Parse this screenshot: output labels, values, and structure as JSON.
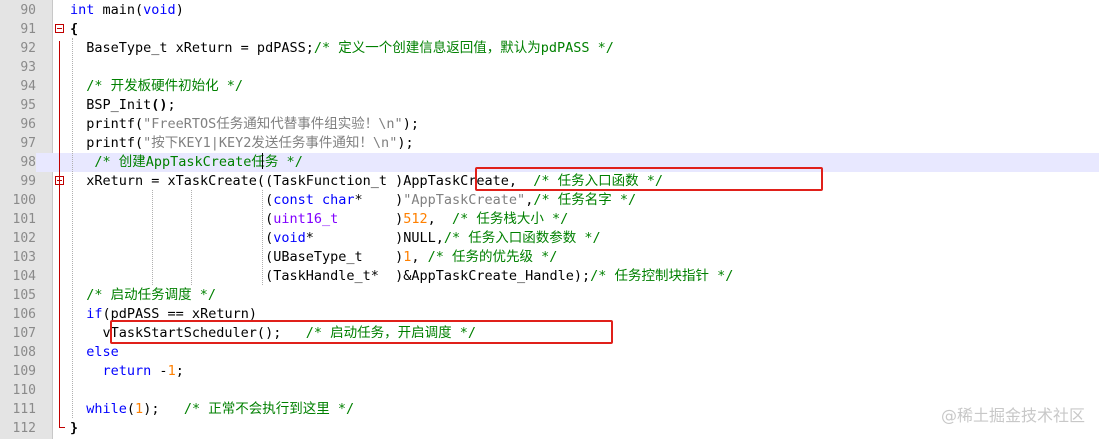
{
  "editor": {
    "lines": [
      {
        "num": "90",
        "tokens": [
          {
            "t": "int",
            "c": "kw"
          },
          {
            "t": " main("
          },
          {
            "t": "void",
            "c": "kw"
          },
          {
            "t": ")"
          }
        ]
      },
      {
        "num": "91",
        "tokens": [
          {
            "t": "{",
            "c": "bold"
          }
        ]
      },
      {
        "num": "92",
        "tokens": [
          {
            "t": "  BaseType_t xReturn = pdPASS;"
          },
          {
            "t": "/* 定义一个创建信息返回值，默认为pdPASS */",
            "c": "cm"
          }
        ]
      },
      {
        "num": "93",
        "tokens": []
      },
      {
        "num": "94",
        "tokens": [
          {
            "t": "  "
          },
          {
            "t": "/* 开发板硬件初始化 */",
            "c": "cm"
          }
        ]
      },
      {
        "num": "95",
        "tokens": [
          {
            "t": "  BSP_Init"
          },
          {
            "t": "()",
            "c": "bold"
          },
          {
            "t": ";"
          }
        ]
      },
      {
        "num": "96",
        "tokens": [
          {
            "t": "  printf("
          },
          {
            "t": "\"FreeRTOS任务通知代替事件组实验！\\n\"",
            "c": "str"
          },
          {
            "t": ");"
          }
        ]
      },
      {
        "num": "97",
        "tokens": [
          {
            "t": "  printf("
          },
          {
            "t": "\"按下KEY1|KEY2发送任务事件通知！\\n\"",
            "c": "str"
          },
          {
            "t": ");"
          }
        ]
      },
      {
        "num": "98",
        "tokens": [
          {
            "t": "   "
          },
          {
            "t": "/* 创建AppTaskCreate任务 */",
            "c": "cm"
          }
        ]
      },
      {
        "num": "99",
        "tokens": [
          {
            "t": "  xReturn = xTaskCreate((TaskFunction_t )AppTaskCreate,  "
          },
          {
            "t": "/* 任务入口函数 */",
            "c": "cm"
          }
        ]
      },
      {
        "num": "100",
        "tokens": [
          {
            "t": "                        ("
          },
          {
            "t": "const char",
            "c": "kw"
          },
          {
            "t": "*    )"
          },
          {
            "t": "\"AppTaskCreate\"",
            "c": "str"
          },
          {
            "t": ","
          },
          {
            "t": "/* 任务名字 */",
            "c": "cm"
          }
        ]
      },
      {
        "num": "101",
        "tokens": [
          {
            "t": "                        ("
          },
          {
            "t": "uint16_t",
            "c": "ty"
          },
          {
            "t": "       )"
          },
          {
            "t": "512",
            "c": "num"
          },
          {
            "t": ",  "
          },
          {
            "t": "/* 任务栈大小 */",
            "c": "cm"
          }
        ]
      },
      {
        "num": "102",
        "tokens": [
          {
            "t": "                        ("
          },
          {
            "t": "void",
            "c": "kw"
          },
          {
            "t": "*          )NULL,"
          },
          {
            "t": "/* 任务入口函数参数 */",
            "c": "cm"
          }
        ]
      },
      {
        "num": "103",
        "tokens": [
          {
            "t": "                        (UBaseType_t    )"
          },
          {
            "t": "1",
            "c": "num"
          },
          {
            "t": ", "
          },
          {
            "t": "/* 任务的优先级 */",
            "c": "cm"
          }
        ]
      },
      {
        "num": "104",
        "tokens": [
          {
            "t": "                        (TaskHandle_t*  )&AppTaskCreate_Handle);"
          },
          {
            "t": "/* 任务控制块指针 */",
            "c": "cm"
          }
        ]
      },
      {
        "num": "105",
        "tokens": [
          {
            "t": "  "
          },
          {
            "t": "/* 启动任务调度 */",
            "c": "cm"
          }
        ]
      },
      {
        "num": "106",
        "tokens": [
          {
            "t": "  "
          },
          {
            "t": "if",
            "c": "kw"
          },
          {
            "t": "(pdPASS == xReturn)"
          }
        ]
      },
      {
        "num": "107",
        "tokens": [
          {
            "t": "    vTaskStartScheduler();   "
          },
          {
            "t": "/* 启动任务，开启调度 */",
            "c": "cm"
          }
        ]
      },
      {
        "num": "108",
        "tokens": [
          {
            "t": "  "
          },
          {
            "t": "else",
            "c": "kw"
          }
        ]
      },
      {
        "num": "109",
        "tokens": [
          {
            "t": "    "
          },
          {
            "t": "return",
            "c": "kw"
          },
          {
            "t": " -"
          },
          {
            "t": "1",
            "c": "num"
          },
          {
            "t": ";"
          }
        ]
      },
      {
        "num": "110",
        "tokens": []
      },
      {
        "num": "111",
        "tokens": [
          {
            "t": "  "
          },
          {
            "t": "while",
            "c": "kw"
          },
          {
            "t": "("
          },
          {
            "t": "1",
            "c": "num"
          },
          {
            "t": ");   "
          },
          {
            "t": "/* 正常不会执行到这里 */",
            "c": "cm"
          }
        ]
      },
      {
        "num": "112",
        "tokens": [
          {
            "t": "}",
            "c": "bold"
          }
        ]
      }
    ],
    "current_line_num": "98"
  },
  "watermark": "@稀土掘金技术社区",
  "colors": {
    "keyword": "#0000ff",
    "type": "#8000ff",
    "number": "#ff8000",
    "string": "#808080",
    "comment": "#008000",
    "highlight_box": "#e0201a",
    "current_line": "#e8e8ff"
  }
}
